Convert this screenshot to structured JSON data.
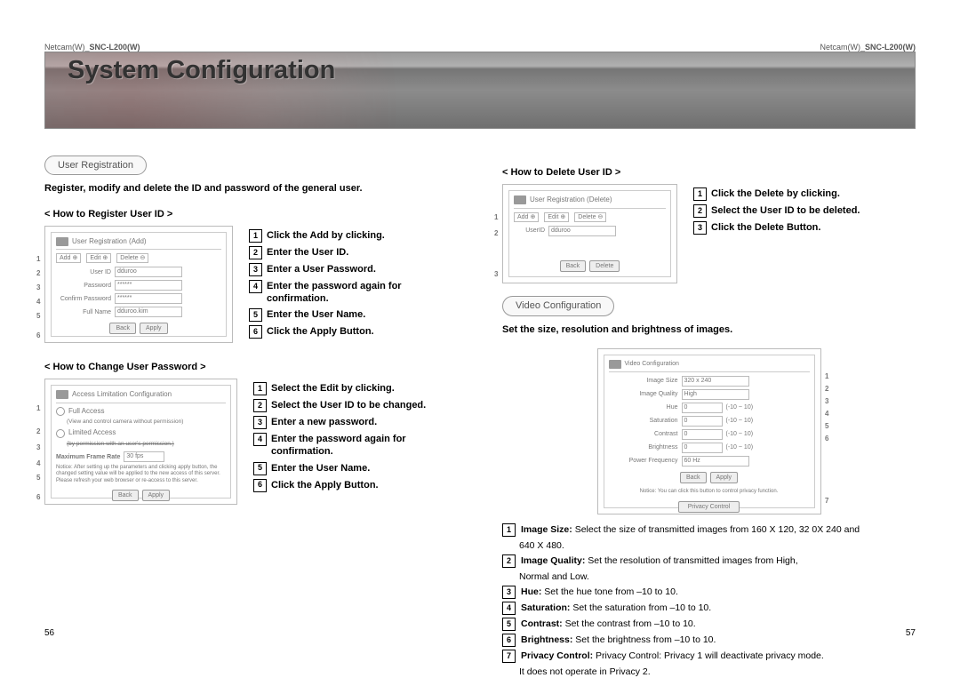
{
  "product_left": "Netcam(W)_SNC-L200(W)",
  "product_right": "Netcam(W)_SNC-L200(W)",
  "banner_title": "System Configuration",
  "page_left_num": "56",
  "page_right_num": "57",
  "user_reg": {
    "pill": "User Registration",
    "intro": "Register, modify and delete the ID and password of the general user.",
    "register": {
      "heading": "< How to Register User ID >",
      "fig": {
        "title": "User Registration (Add)",
        "tabs": {
          "add": "Add",
          "edit": "Edit",
          "delete": "Delete"
        },
        "fields": {
          "userid_lbl": "User ID",
          "userid_val": "dduroo",
          "pass_lbl": "Password",
          "pass_val": "******",
          "confirm_lbl": "Confirm Password",
          "confirm_val": "******",
          "fullname_lbl": "Full Name",
          "fullname_val": "dduroo.kim"
        },
        "btns": {
          "back": "Back",
          "apply": "Apply"
        },
        "callouts": [
          "1",
          "2",
          "3",
          "4",
          "5",
          "6"
        ]
      },
      "steps": [
        "Click the Add by clicking.",
        "Enter the User ID.",
        "Enter a User Password.",
        "Enter the password again for confirmation.",
        "Enter the User Name.",
        "Click the Apply Button."
      ]
    },
    "change": {
      "heading": "< How to Change User Password >",
      "fig": {
        "title": "Access Limitation Configuration",
        "full": "Full Access",
        "full_note": "(View and control camera without permission)",
        "limited": "Limited Access",
        "limited_note": "(by permission with an user's permission.)",
        "rate_lbl": "Maximum Frame Rate",
        "rate_val": "30 fps",
        "notice": "Notice: After setting up the parameters and clicking apply button, the changed setting value will be applied to the new access of this server. Please refresh your web browser or re-access to this server.",
        "btns": {
          "back": "Back",
          "apply": "Apply"
        },
        "callouts": [
          "1",
          "2",
          "3",
          "4",
          "5",
          "6"
        ]
      },
      "steps": [
        "Select the Edit by clicking.",
        "Select the User ID to be changed.",
        "Enter a new password.",
        "Enter the password again for confirmation.",
        "Enter the User Name.",
        "Click the Apply Button."
      ]
    }
  },
  "delete": {
    "heading": "< How to Delete User ID >",
    "fig": {
      "title": "User Registration (Delete)",
      "tabs": {
        "add": "Add",
        "edit": "Edit",
        "delete": "Delete"
      },
      "userid_lbl": "UserID",
      "userid_val": "dduroo",
      "btns": {
        "back": "Back",
        "delete": "Delete"
      },
      "callouts": [
        "1",
        "2",
        "3"
      ]
    },
    "steps": [
      "Click the Delete by clicking.",
      "Select the User ID to be deleted.",
      "Click the Delete Button."
    ]
  },
  "video": {
    "pill": "Video Configuration",
    "intro": "Set the size, resolution and brightness of images.",
    "fig": {
      "title": "Video Configuration",
      "rows": {
        "size_lbl": "Image Size",
        "size_val": "320 x 240",
        "quality_lbl": "Image Quality",
        "quality_val": "High",
        "hue_lbl": "Hue",
        "hue_val": "0",
        "hue_range": "(-10 ~ 10)",
        "sat_lbl": "Saturation",
        "sat_val": "0",
        "sat_range": "(-10 ~ 10)",
        "con_lbl": "Contrast",
        "con_val": "0",
        "con_range": "(-10 ~ 10)",
        "bri_lbl": "Brightness",
        "bri_val": "0",
        "bri_range": "(-10 ~ 10)",
        "freq_lbl": "Power Frequency",
        "freq_val": "60 Hz"
      },
      "btns": {
        "back": "Back",
        "apply": "Apply"
      },
      "notice": "Notice: You can click this button to control privacy function.",
      "privacy_btn": "Privacy Control",
      "callouts": [
        "1",
        "2",
        "3",
        "4",
        "5",
        "6",
        "7"
      ]
    },
    "items": [
      {
        "label": "Image Size:",
        "text": "Select the size of transmitted images from 160 X 120, 32 0X 240 and",
        "cont": "640 X 480."
      },
      {
        "label": "Image Quality:",
        "text": "Set the resolution of transmitted images from High,",
        "cont": "Normal and Low."
      },
      {
        "label": "Hue:",
        "text": "Set the hue tone from –10 to 10."
      },
      {
        "label": "Saturation:",
        "text": "Set the saturation from –10 to 10."
      },
      {
        "label": "Contrast:",
        "text": "Set the contrast from –10 to 10."
      },
      {
        "label": "Brightness:",
        "text": "Set the brightness from –10 to 10."
      },
      {
        "label": "Privacy Control:",
        "text": "Privacy Control: Privacy 1 will deactivate privacy mode.",
        "cont": "It does not operate in Privacy 2."
      }
    ]
  }
}
